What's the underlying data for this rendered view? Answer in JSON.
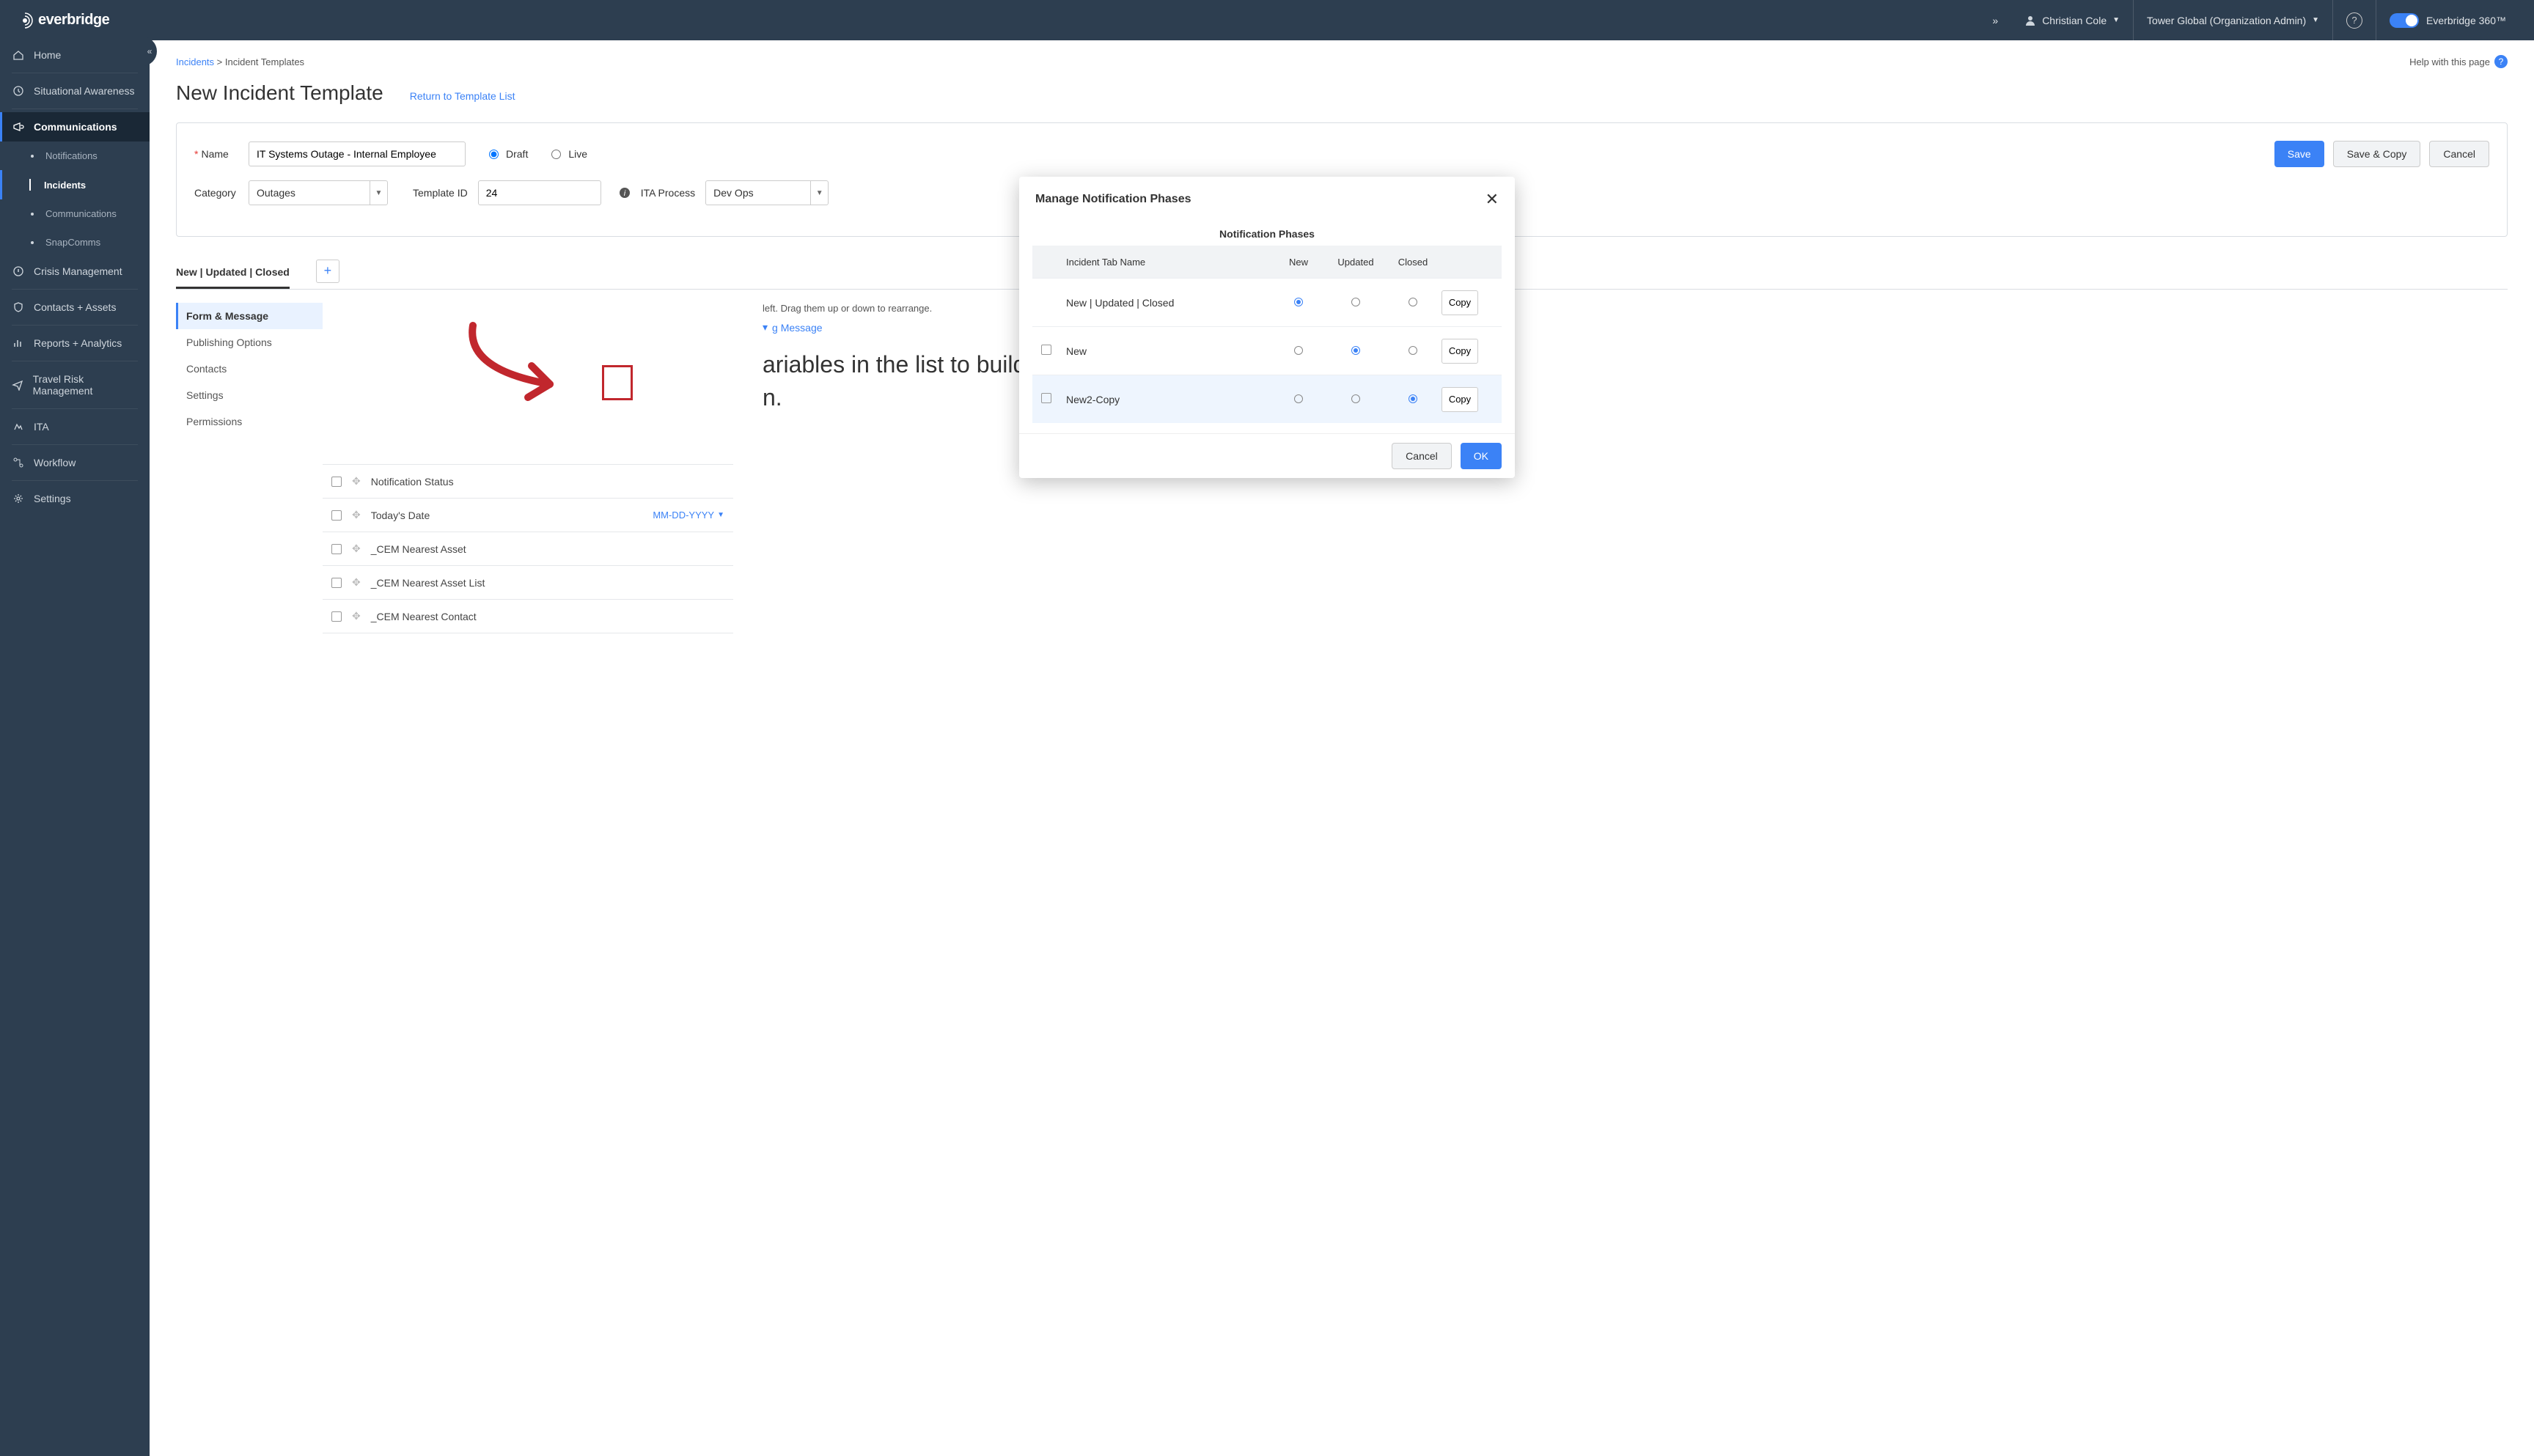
{
  "header": {
    "brand": "everbridge",
    "user_name": "Christian Cole",
    "org_context": "Tower Global (Organization Admin)",
    "product": "Everbridge 360™"
  },
  "sidebar": {
    "items": [
      {
        "label": "Home",
        "icon": "home"
      },
      {
        "label": "Situational Awareness",
        "icon": "clock"
      },
      {
        "label": "Communications",
        "icon": "megaphone",
        "active": true
      },
      {
        "label": "Notifications",
        "sub": true
      },
      {
        "label": "Incidents",
        "sub": true,
        "active_sub": true
      },
      {
        "label": "Communications",
        "sub": true
      },
      {
        "label": "SnapComms",
        "sub": true
      },
      {
        "label": "Crisis Management",
        "icon": "alert"
      },
      {
        "label": "Contacts + Assets",
        "icon": "shield"
      },
      {
        "label": "Reports + Analytics",
        "icon": "chart"
      },
      {
        "label": "Travel Risk Management",
        "icon": "plane"
      },
      {
        "label": "ITA",
        "icon": "ita"
      },
      {
        "label": "Workflow",
        "icon": "workflow"
      },
      {
        "label": "Settings",
        "icon": "gear"
      }
    ]
  },
  "breadcrumb": {
    "link": "Incidents",
    "current": "Incident Templates",
    "help_text": "Help with this page"
  },
  "page_title": "New Incident Template",
  "return_link": "Return to Template List",
  "form": {
    "name_label": "Name",
    "name_value": "IT Systems Outage - Internal Employee",
    "draft_label": "Draft",
    "live_label": "Live",
    "save_btn": "Save",
    "save_copy_btn": "Save & Copy",
    "cancel_btn": "Cancel",
    "category_label": "Category",
    "category_value": "Outages",
    "template_id_label": "Template ID",
    "template_id_value": "24",
    "ita_label": "ITA Process",
    "ita_value": "Dev Ops"
  },
  "tabs": {
    "active": "New | Updated | Closed"
  },
  "sidenav2": [
    "Form & Message",
    "Publishing Options",
    "Contacts",
    "Settings",
    "Permissions"
  ],
  "variables": [
    {
      "name": "Notification Status"
    },
    {
      "name": "Today's Date",
      "fmt": "MM-DD-YYYY"
    },
    {
      "name": "_CEM Nearest Asset"
    },
    {
      "name": "_CEM Nearest Asset List"
    },
    {
      "name": "_CEM Nearest Contact"
    }
  ],
  "message_preview": {
    "hint_suffix": "left. Drag them up or down to rearrange.",
    "outgoing": "g Message",
    "body_line1_suffix": "ariables in the list to build",
    "body_line2_suffix": "n."
  },
  "modal": {
    "title": "Manage Notification Phases",
    "phases_header": "Notification Phases",
    "col_name": "Incident Tab Name",
    "col_new": "New",
    "col_updated": "Updated",
    "col_closed": "Closed",
    "rows": [
      {
        "name": "New | Updated | Closed",
        "phase": "new",
        "first": true
      },
      {
        "name": "New",
        "phase": "updated"
      },
      {
        "name": "New2-Copy",
        "phase": "closed",
        "highlighted": true
      }
    ],
    "copy_btn": "Copy",
    "cancel_btn": "Cancel",
    "ok_btn": "OK"
  }
}
